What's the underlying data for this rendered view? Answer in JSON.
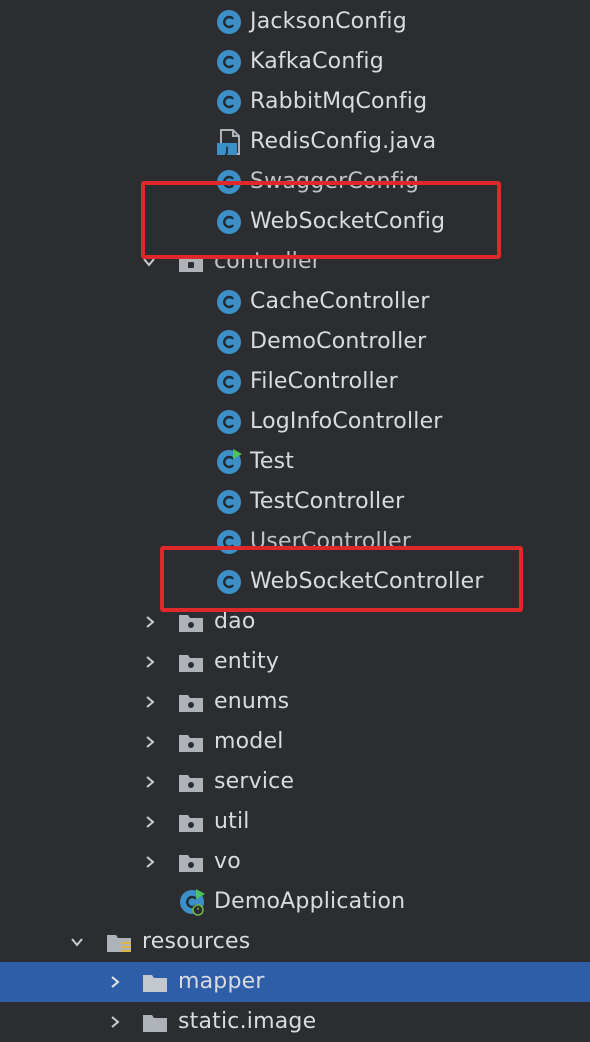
{
  "project_tree": {
    "config_classes": [
      {
        "label": "JacksonConfig",
        "icon": "class-icon"
      },
      {
        "label": "KafkaConfig",
        "icon": "class-icon"
      },
      {
        "label": "RabbitMqConfig",
        "icon": "class-icon"
      },
      {
        "label": "RedisConfig.java",
        "icon": "java-file-icon"
      },
      {
        "label": "SwaggerConfig",
        "icon": "class-icon"
      },
      {
        "label": "WebSocketConfig",
        "icon": "class-icon"
      }
    ],
    "controller_folder": {
      "label": "controller",
      "expanded": true
    },
    "controller_classes": [
      {
        "label": "CacheController",
        "icon": "class-icon"
      },
      {
        "label": "DemoController",
        "icon": "class-icon"
      },
      {
        "label": "FileController",
        "icon": "class-icon"
      },
      {
        "label": "LogInfoController",
        "icon": "class-icon"
      },
      {
        "label": "Test",
        "icon": "runnable-class-icon"
      },
      {
        "label": "TestController",
        "icon": "class-icon"
      },
      {
        "label": "UserController",
        "icon": "class-icon"
      },
      {
        "label": "WebSocketController",
        "icon": "class-icon"
      }
    ],
    "packages": [
      {
        "label": "dao",
        "expanded": false
      },
      {
        "label": "entity",
        "expanded": false
      },
      {
        "label": "enums",
        "expanded": false
      },
      {
        "label": "model",
        "expanded": false
      },
      {
        "label": "service",
        "expanded": false
      },
      {
        "label": "util",
        "expanded": false
      },
      {
        "label": "vo",
        "expanded": false
      }
    ],
    "main_class": {
      "label": "DemoApplication",
      "icon": "spring-boot-app-icon"
    },
    "resources_folder": {
      "label": "resources",
      "expanded": true
    },
    "resource_children": [
      {
        "label": "mapper",
        "expanded": false,
        "selected": true
      },
      {
        "label": "static.image",
        "expanded": false,
        "selected": false
      }
    ]
  },
  "colors": {
    "background": "#2b2d30",
    "selection": "#2e5ea8",
    "class_icon": "#3d8fc7",
    "highlight_box": "#e0282a",
    "folder_icon": "#aeb3ba"
  }
}
